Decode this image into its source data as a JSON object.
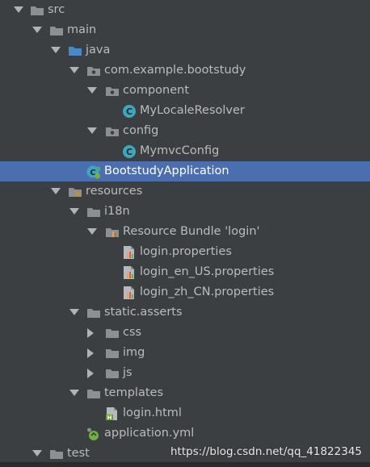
{
  "colors": {
    "background": "#3c3f41",
    "selection": "#4b6eaf",
    "text": "#bbbbbb",
    "folder_gray": "#8c9094",
    "folder_blue": "#4a88c7",
    "class_badge": "#3fa7bd"
  },
  "tree": [
    {
      "label": "src",
      "icon": "folder-icon",
      "expanded": true
    },
    {
      "label": "main",
      "icon": "folder-icon",
      "expanded": true
    },
    {
      "label": "java",
      "icon": "source-folder-icon",
      "expanded": true
    },
    {
      "label": "com.example.bootstudy",
      "icon": "package-icon",
      "expanded": true
    },
    {
      "label": "component",
      "icon": "package-icon",
      "expanded": true
    },
    {
      "label": "MyLocaleResolver",
      "icon": "class-icon"
    },
    {
      "label": "config",
      "icon": "package-icon",
      "expanded": true
    },
    {
      "label": "MymvcConfig",
      "icon": "class-icon"
    },
    {
      "label": "BootstudyApplication",
      "icon": "spring-boot-class-icon",
      "selected": true
    },
    {
      "label": "resources",
      "icon": "resources-folder-icon",
      "expanded": true
    },
    {
      "label": "i18n",
      "icon": "folder-icon",
      "expanded": true
    },
    {
      "label": "Resource Bundle 'login'",
      "icon": "resource-bundle-icon",
      "expanded": true
    },
    {
      "label": "login.properties",
      "icon": "properties-file-icon"
    },
    {
      "label": "login_en_US.properties",
      "icon": "properties-file-icon"
    },
    {
      "label": "login_zh_CN.properties",
      "icon": "properties-file-icon"
    },
    {
      "label": "static.asserts",
      "icon": "folder-icon",
      "expanded": true
    },
    {
      "label": "css",
      "icon": "folder-icon",
      "expanded": false
    },
    {
      "label": "img",
      "icon": "folder-icon",
      "expanded": false
    },
    {
      "label": "js",
      "icon": "folder-icon",
      "expanded": false
    },
    {
      "label": "templates",
      "icon": "folder-icon",
      "expanded": true
    },
    {
      "label": "login.html",
      "icon": "html-file-icon"
    },
    {
      "label": "application.yml",
      "icon": "yaml-file-icon"
    },
    {
      "label": "test",
      "icon": "folder-icon",
      "expanded": true
    }
  ],
  "watermark": "https://blog.csdn.net/qq_41822345"
}
